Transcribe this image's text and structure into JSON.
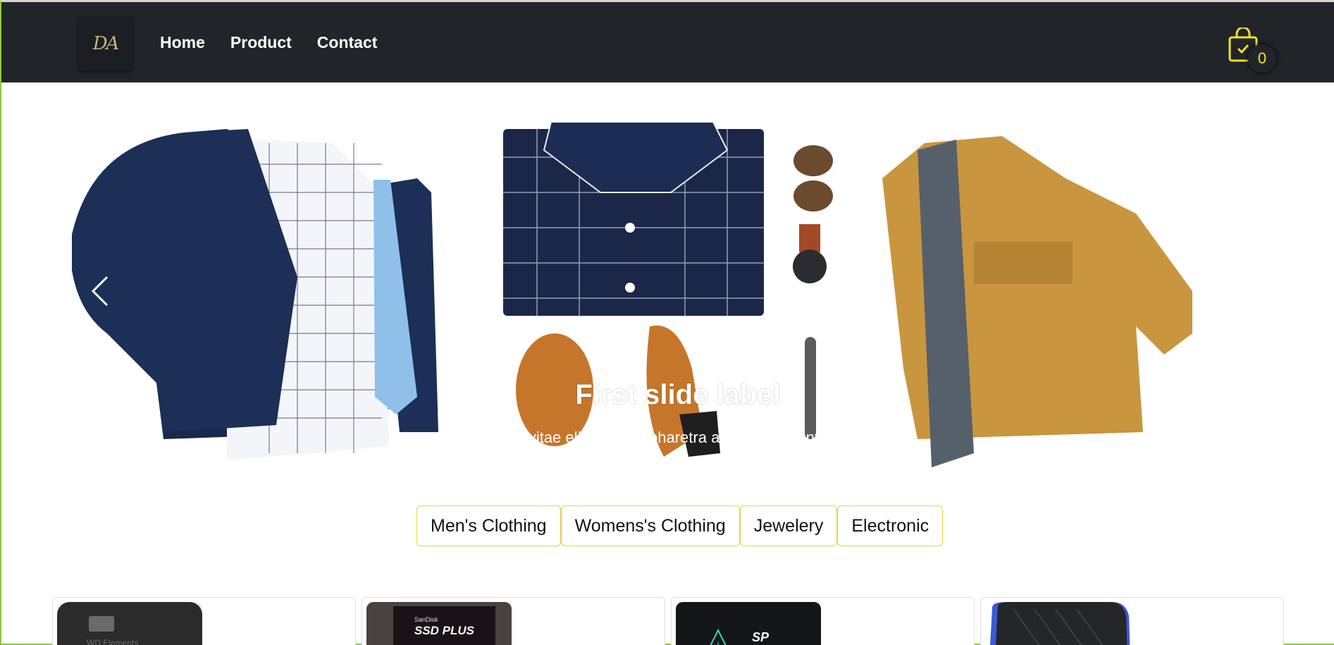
{
  "nav": {
    "logo_text": "DA",
    "links": [
      "Home",
      "Product",
      "Contact"
    ],
    "cart_count": "0"
  },
  "carousel": {
    "caption_title": "First slide label",
    "caption_text": "Nulla vitae elit libero, a pharetra augue mollis interdum."
  },
  "categories": [
    "Men's Clothing",
    "Womens's Clothing",
    "Jewelery",
    "Electronic"
  ],
  "cards": [
    {
      "label": "WD Elements"
    },
    {
      "label": "SSD PLUS",
      "brand": "SanDisk"
    },
    {
      "label": "SP"
    },
    {
      "label": ""
    }
  ],
  "colors": {
    "navbar": "#212529",
    "accent": "#f3e02a",
    "category_border": "#e8d04b"
  }
}
